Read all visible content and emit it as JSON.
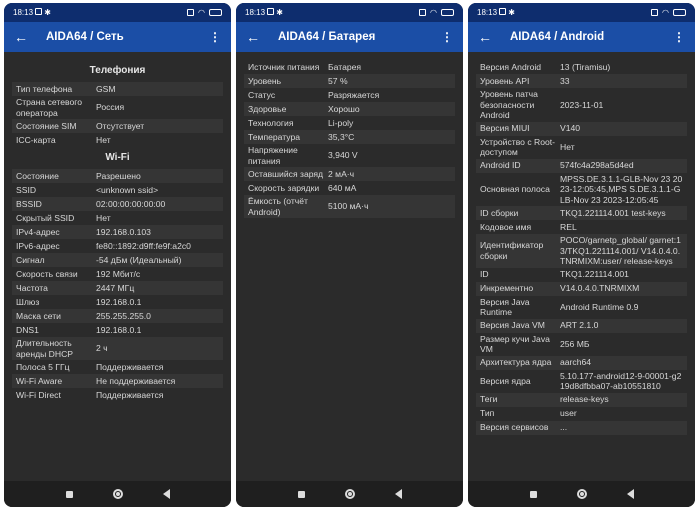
{
  "status_time": "18:13",
  "screens": [
    {
      "title": "AIDA64  /  Сеть",
      "sections": [
        {
          "header": "Телефония",
          "rows": [
            [
              "Тип телефона",
              "GSM"
            ],
            [
              "Страна сетевого оператора",
              "Россия"
            ],
            [
              "Состояние SIM",
              "Отсутствует"
            ],
            [
              "ICC-карта",
              "Нет"
            ]
          ]
        },
        {
          "header": "Wi-Fi",
          "rows": [
            [
              "Состояние",
              "Разрешено"
            ],
            [
              "SSID",
              "<unknown ssid>"
            ],
            [
              "BSSID",
              "02:00:00:00:00:00"
            ],
            [
              "Скрытый SSID",
              "Нет"
            ],
            [
              "IPv4-адрес",
              "192.168.0.103"
            ],
            [
              "IPv6-адрес",
              "fe80::1892:d9ff:fe9f:a2c0"
            ],
            [
              "Сигнал",
              "-54 дБм (Идеальный)"
            ],
            [
              "Скорость связи",
              "192 Мбит/с"
            ],
            [
              "Частота",
              "2447 МГц"
            ],
            [
              "Шлюз",
              "192.168.0.1"
            ],
            [
              "Маска сети",
              "255.255.255.0"
            ],
            [
              "DNS1",
              "192.168.0.1"
            ],
            [
              "Длительность аренды DHCP",
              "2 ч"
            ],
            [
              "Полоса 5 ГГц",
              "Поддерживается"
            ],
            [
              "Wi-Fi Aware",
              "Не поддерживается"
            ],
            [
              "Wi-Fi Direct",
              "Поддерживается"
            ]
          ]
        }
      ]
    },
    {
      "title": "AIDA64  /  Батарея",
      "sections": [
        {
          "header": "",
          "rows": [
            [
              "Источник питания",
              "Батарея"
            ],
            [
              "Уровень",
              "57 %"
            ],
            [
              "Статус",
              "Разряжается"
            ],
            [
              "Здоровье",
              "Хорошо"
            ],
            [
              "Технология",
              "Li-poly"
            ],
            [
              "Температура",
              "35,3°C"
            ],
            [
              "Напряжение питания",
              "3,940 V"
            ],
            [
              "Оставшийся заряд",
              "2 мА·ч"
            ],
            [
              "Скорость зарядки",
              "640 мА"
            ],
            [
              "Ёмкость (отчёт Android)",
              "5100 мА·ч"
            ]
          ]
        }
      ]
    },
    {
      "title": "AIDA64  /  Android",
      "sections": [
        {
          "header": "",
          "rows": [
            [
              "Версия Android",
              "13 (Tiramisu)"
            ],
            [
              "Уровень API",
              "33"
            ],
            [
              "Уровень патча безопасности Android",
              "2023-11-01"
            ],
            [
              "Версия MIUI",
              "V140"
            ],
            [
              "Устройство с Root-доступом",
              "Нет"
            ],
            [
              "Android ID",
              "574fc4a298a5d4ed"
            ],
            [
              "Основная полоса",
              "MPSS.DE.3.1.1-GLB-Nov 23 2023-12:05:45,MPS S.DE.3.1.1-GLB-Nov 23 2023-12:05:45"
            ],
            [
              "ID сборки",
              "TKQ1.221114.001 test-keys"
            ],
            [
              "Кодовое имя",
              "REL"
            ],
            [
              "Идентификатор сборки",
              "POCO/garnetp_global/ garnet:13/TKQ1.221114.001/ V14.0.4.0.TNRMIXM:user/ release-keys"
            ],
            [
              "ID",
              "TKQ1.221114.001"
            ],
            [
              "Инкрементно",
              "V14.0.4.0.TNRMIXM"
            ],
            [
              "Версия Java Runtime",
              "Android Runtime 0.9"
            ],
            [
              "Версия Java VM",
              "ART 2.1.0"
            ],
            [
              "Размер кучи Java VM",
              "256 МБ"
            ],
            [
              "Архитектура ядра",
              "aarch64"
            ],
            [
              "Версия ядра",
              "5.10.177-android12-9-00001-g219d8dfbba07-ab10551810"
            ],
            [
              "Теги",
              "release-keys"
            ],
            [
              "Тип",
              "user"
            ],
            [
              "Версия сервисов",
              "..."
            ]
          ]
        }
      ]
    }
  ]
}
